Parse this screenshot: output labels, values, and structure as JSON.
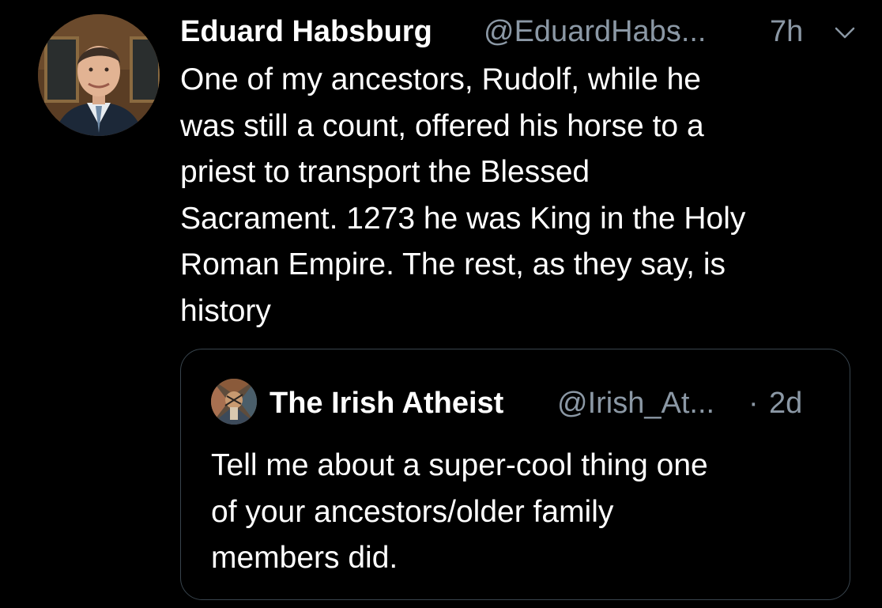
{
  "tweet": {
    "author": {
      "display_name": "Eduard Habsburg",
      "handle": "@EduardHabs...",
      "avatar_icon": "profile-photo-avatar"
    },
    "separator": "·",
    "time": "7h",
    "menu_icon": "chevron-down-icon",
    "body_lines": [
      "One of my ancestors, Rudolf, while he",
      "was still a count, offered his horse to a",
      "priest to transport the Blessed",
      "Sacrament. 1273 he was King in the Holy",
      "Roman Empire. The rest, as they say, is",
      "history"
    ]
  },
  "quoted_tweet": {
    "author": {
      "display_name": "The Irish Atheist",
      "handle": "@Irish_At...",
      "avatar_icon": "stained-glass-avatar"
    },
    "separator": "·",
    "time": "2d",
    "body_lines": [
      "Tell me about a super-cool thing one",
      "of your ancestors/older family",
      "members did."
    ]
  },
  "colors": {
    "background": "#000000",
    "primary_text": "#ffffff",
    "secondary_text": "#8b98a5",
    "border": "#38444d"
  }
}
